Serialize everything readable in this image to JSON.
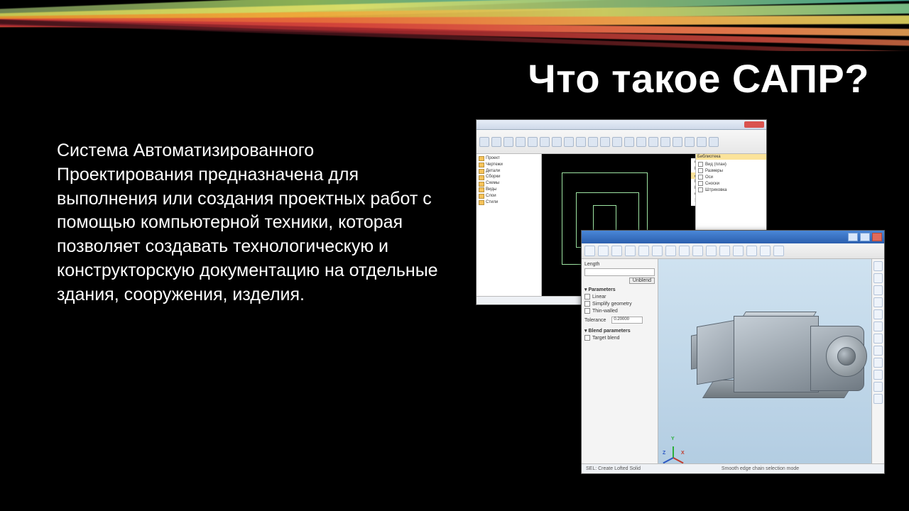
{
  "title": "Что такое САПР?",
  "body": "Система Автоматизированного Проектирования предназначена для выполнения или создания проектных работ с помощью компьютерной техники, которая позволяет создавать технологическую и конструкторскую документацию на отдельные здания, сооружения, изделия.",
  "winB": {
    "side": {
      "group1": "Parameters",
      "opt_linear": "Linear",
      "opt_simplify": "Simplify geometry",
      "opt_thinwalled": "Thin-walled",
      "tolerance_label": "Tolerance",
      "tolerance_value": "0.20000",
      "group2": "Blend parameters",
      "opt_target": "Target blend",
      "length_label": "Length",
      "unblend_btn": "Unblend"
    },
    "status_left": "SEL: Create Lofted Solid",
    "status_mid": "Smooth edge chain selection mode"
  },
  "triad": {
    "x": "X",
    "y": "Y",
    "z": "Z"
  }
}
